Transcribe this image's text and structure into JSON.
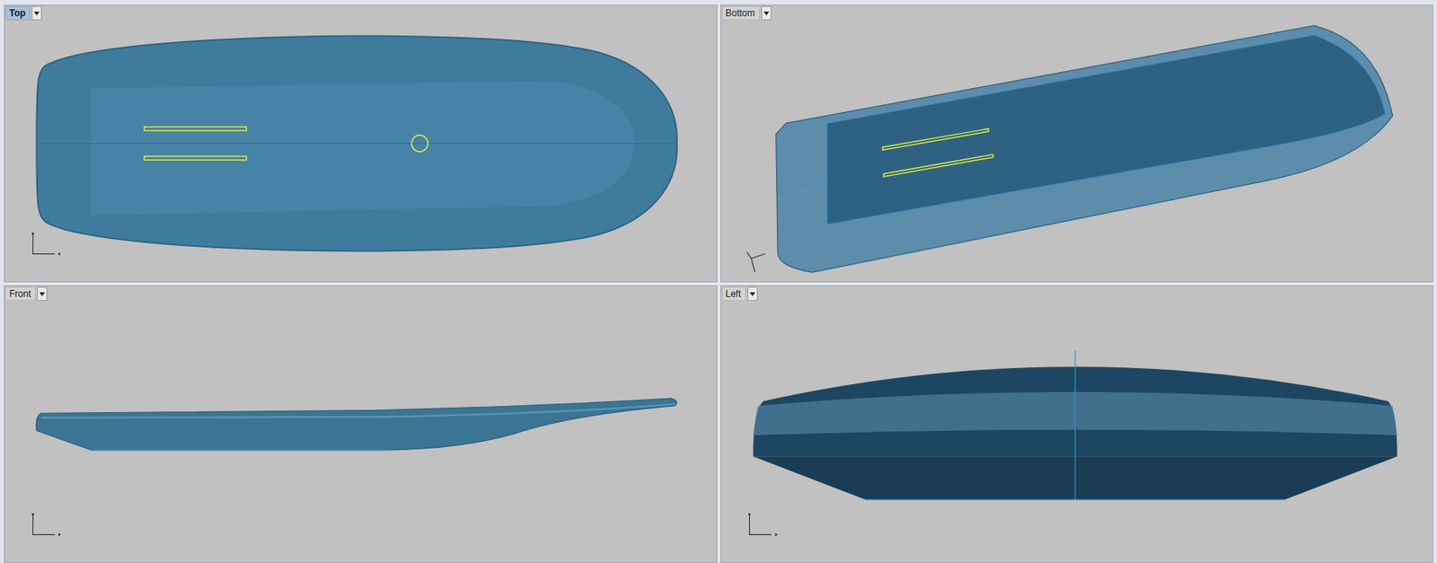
{
  "viewports": [
    {
      "label": "Top",
      "selected": true,
      "kind": "top"
    },
    {
      "label": "Bottom",
      "selected": false,
      "kind": "bottom"
    },
    {
      "label": "Front",
      "selected": false,
      "kind": "front"
    },
    {
      "label": "Left",
      "selected": false,
      "kind": "left"
    }
  ]
}
